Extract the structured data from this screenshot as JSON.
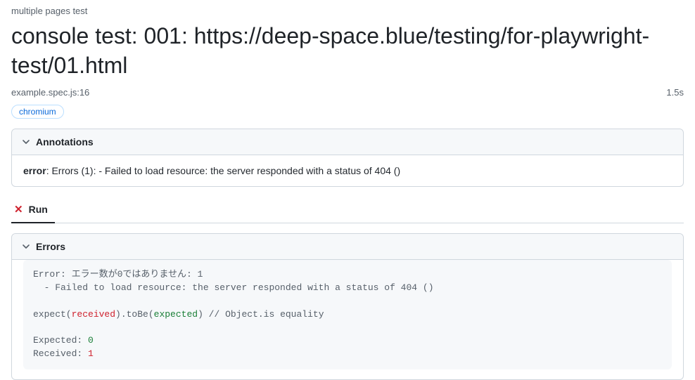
{
  "breadcrumb": "multiple pages test",
  "title": "console test: 001: https://deep-space.blue/testing/for-playwright-test/01.html",
  "file_location": "example.spec.js:16",
  "duration": "1.5s",
  "browser_chip": "chromium",
  "annotations": {
    "header": "Annotations",
    "error_label": "error",
    "error_text": ": Errors (1): - Failed to load resource: the server responded with a status of 404 ()"
  },
  "tab": {
    "label": "Run"
  },
  "errors": {
    "header": "Errors",
    "line1": "Error: エラー数が0ではありません: 1",
    "line2": "  - Failed to load resource: the server responded with a status of 404 ()",
    "expect_pre": "expect(",
    "received_tok": "received",
    "expect_mid": ").toBe(",
    "expected_tok": "expected",
    "expect_post": ") // Object.is equality",
    "expected_label": "Expected: ",
    "expected_val": "0",
    "received_label": "Received: ",
    "received_val": "1"
  }
}
